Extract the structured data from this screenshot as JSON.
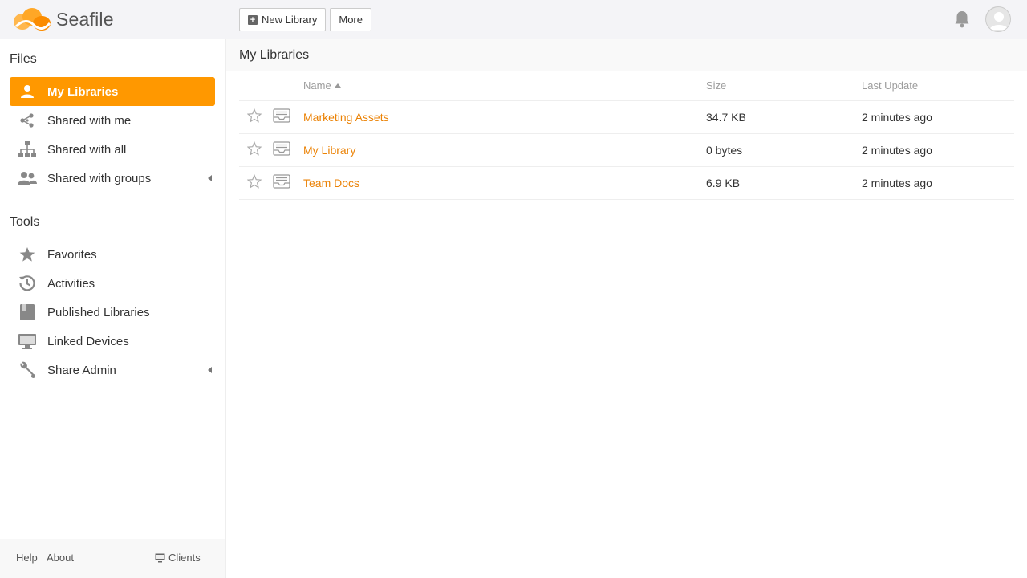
{
  "app": {
    "name": "Seafile"
  },
  "toolbar": {
    "new_library": "New Library",
    "more": "More"
  },
  "sidebar": {
    "files_title": "Files",
    "files_items": [
      {
        "label": "My Libraries",
        "icon": "user-icon",
        "active": true
      },
      {
        "label": "Shared with me",
        "icon": "share-icon"
      },
      {
        "label": "Shared with all",
        "icon": "org-chart-icon"
      },
      {
        "label": "Shared with groups",
        "icon": "group-icon",
        "expandable": true
      }
    ],
    "tools_title": "Tools",
    "tools_items": [
      {
        "label": "Favorites",
        "icon": "star-icon"
      },
      {
        "label": "Activities",
        "icon": "history-icon"
      },
      {
        "label": "Published Libraries",
        "icon": "book-icon"
      },
      {
        "label": "Linked Devices",
        "icon": "monitor-icon"
      },
      {
        "label": "Share Admin",
        "icon": "wrench-icon",
        "expandable": true
      }
    ],
    "footer": {
      "help": "Help",
      "about": "About",
      "clients": "Clients"
    }
  },
  "main": {
    "title": "My Libraries",
    "columns": {
      "name": "Name",
      "size": "Size",
      "last_update": "Last Update"
    },
    "rows": [
      {
        "name": "Marketing Assets",
        "size": "34.7 KB",
        "last_update": "2 minutes ago"
      },
      {
        "name": "My Library",
        "size": "0 bytes",
        "last_update": "2 minutes ago"
      },
      {
        "name": "Team Docs",
        "size": "6.9 KB",
        "last_update": "2 minutes ago"
      }
    ]
  },
  "colors": {
    "accent": "#ff9800",
    "link": "#eb8205"
  }
}
